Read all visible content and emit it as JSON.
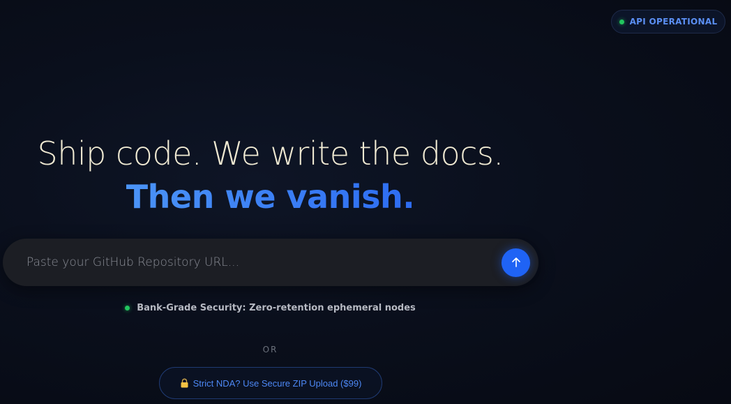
{
  "status": {
    "label": "API OPERATIONAL",
    "color": "#22c55e"
  },
  "hero": {
    "headline": "Ship code. We write the docs.",
    "subheadline": "Then we vanish."
  },
  "repo_input": {
    "placeholder": "Paste your GitHub Repository URL...",
    "value": "",
    "submit_icon": "arrow-up-icon"
  },
  "security_note": {
    "text": "Bank-Grade Security: Zero-retention ephemeral nodes"
  },
  "divider": {
    "text": "OR"
  },
  "zip_upload": {
    "icon": "lock-icon",
    "label": "Strict NDA? Use Secure ZIP Upload ($99)"
  },
  "colors": {
    "accent": "#1f63f5",
    "status_green": "#22c55e",
    "headline_cream": "#efe9d2",
    "background": "#0a0f1c"
  }
}
